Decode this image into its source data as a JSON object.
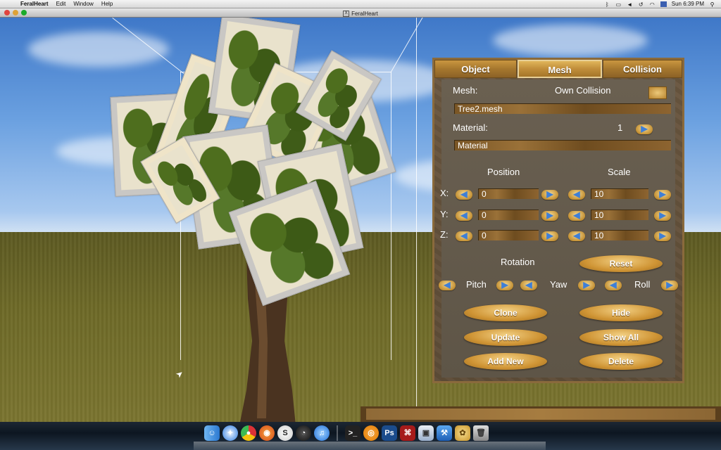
{
  "menubar": {
    "app_name": "FeralHeart",
    "menus": [
      "Edit",
      "Window",
      "Help"
    ],
    "clock": "Sun 6:39 PM"
  },
  "window": {
    "title": "FeralHeart"
  },
  "panel": {
    "tabs": {
      "object": "Object",
      "mesh": "Mesh",
      "collision": "Collision"
    },
    "mesh_label": "Mesh:",
    "own_collision_label": "Own  Collision",
    "mesh_value": "Tree2.mesh",
    "material_label": "Material:",
    "material_index": "1",
    "material_value": "Material",
    "position_label": "Position",
    "scale_label": "Scale",
    "axes": [
      {
        "label": "X:",
        "position": "0",
        "scale": "10"
      },
      {
        "label": "Y:",
        "position": "0",
        "scale": "10"
      },
      {
        "label": "Z:",
        "position": "0",
        "scale": "10"
      }
    ],
    "rotation_label": "Rotation",
    "reset_label": "Reset",
    "pitch_label": "Pitch",
    "yaw_label": "Yaw",
    "roll_label": "Roll",
    "buttons": {
      "clone": "Clone",
      "hide": "Hide",
      "update": "Update",
      "show_all": "Show  All",
      "add_new": "Add  New",
      "delete": "Delete"
    }
  },
  "dock": {
    "icons": [
      "finder-icon",
      "safari-icon",
      "chrome-icon",
      "firefox-icon",
      "skype-icon",
      "dashboard-icon",
      "itunes-icon",
      "terminal-icon",
      "blender-icon",
      "photoshop-icon",
      "adobe-reader-icon",
      "preview-icon",
      "xcode-icon",
      "feralheart-icon",
      "trash-icon"
    ],
    "photoshop_label": "Ps"
  },
  "colors": {
    "accent_gold": "#c99640",
    "panel_bg": "#5e5547",
    "arrow_blue": "#3f7fd6"
  }
}
